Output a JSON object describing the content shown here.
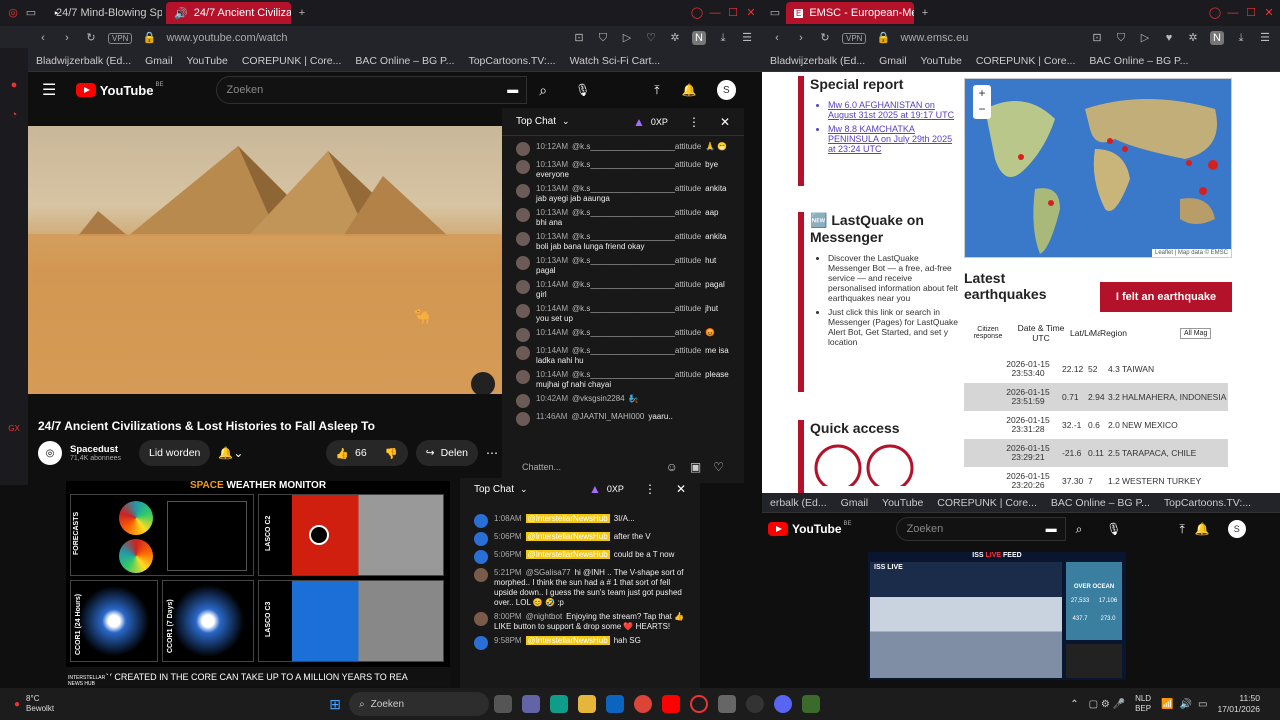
{
  "left_browser": {
    "tabs": [
      {
        "label": "24/7 Mind-Blowing Space"
      },
      {
        "label": "24/7 Ancient Civilizati"
      }
    ],
    "url": "www.youtube.com/watch",
    "vpn": "VPN",
    "bookmarks": [
      "Bladwijzerbalk (Ed...",
      "Gmail",
      "YouTube",
      "COREPUNK | Core...",
      "BAC Online – BG P...",
      "TopCartoons.TV:...",
      "Watch Sci-Fi Cart..."
    ]
  },
  "right_browser": {
    "tab": "EMSC - European-Mediter",
    "url": "www.emsc.eu",
    "vpn": "VPN",
    "bookmarks": [
      "Bladwijzerbalk (Ed...",
      "Gmail",
      "YouTube",
      "COREPUNK | Core...",
      "BAC Online – BG P..."
    ]
  },
  "youtube": {
    "logo": "YouTube",
    "region": "BE",
    "search_placeholder": "Zoeken",
    "avatar": "S",
    "video_title": "24/7 Ancient Civilizations & Lost Histories to Fall Asleep To",
    "channel": "Spacedust",
    "subs": "71,4K abonnees",
    "join": "Lid worden",
    "likes": "66",
    "share": "Delen"
  },
  "chat1": {
    "header": "Top Chat",
    "xp": "0XP",
    "placeholder": "Chatten...",
    "messages": [
      {
        "time": "10:12AM",
        "author": "@k.s___________________attitude",
        "text": "🙏 😁"
      },
      {
        "time": "10:13AM",
        "author": "@k.s___________________attitude",
        "text": "bye everyone"
      },
      {
        "time": "10:13AM",
        "author": "@k.s___________________attitude",
        "text": "ankita jab ayegi jab aaunga"
      },
      {
        "time": "10:13AM",
        "author": "@k.s___________________attitude",
        "text": "aap bhi ana"
      },
      {
        "time": "10:13AM",
        "author": "@k.s___________________attitude",
        "text": "ankita boli jab bana lunga friend okay"
      },
      {
        "time": "10:13AM",
        "author": "@k.s___________________attitude",
        "text": "hut pagal"
      },
      {
        "time": "10:14AM",
        "author": "@k.s___________________attitude",
        "text": "pagal girl"
      },
      {
        "time": "10:14AM",
        "author": "@k.s___________________attitude",
        "text": "jhut you set up"
      },
      {
        "time": "10:14AM",
        "author": "@k.s___________________attitude",
        "text": "😡"
      },
      {
        "time": "10:14AM",
        "author": "@k.s___________________attitude",
        "text": "me isa ladka nahi hu"
      },
      {
        "time": "10:14AM",
        "author": "@k.s___________________attitude",
        "text": "please mujhai gf nahi chayai"
      },
      {
        "time": "10:42AM",
        "author": "@vksgsin2284",
        "text": "🧞"
      },
      {
        "time": "11:46AM",
        "author": "@JAATNI_MAHI000",
        "text": "yaaru.."
      }
    ]
  },
  "space": {
    "title_a": "SPACE",
    "title_b": "WEATHER MONITOR",
    "labels": [
      "FORECASTS",
      "LASCO C2",
      "CCOR1 (24 Hours)",
      "CCOR1 (7 Days)",
      "LASCO C3"
    ],
    "date": "2026-01-21 00:00Z",
    "ticker": "Y CREATED IN THE CORE CAN TAKE UP TO A MILLION YEARS TO REA",
    "hub": "INTERSTELLAR NEWS HUB"
  },
  "chat2": {
    "header": "Top Chat",
    "xp": "0XP",
    "messages": [
      {
        "time": "1:08AM",
        "author": "@InterstellarNewsHub",
        "text": "3I/A..."
      },
      {
        "time": "5:06PM",
        "author": "@InterstellarNewsHub",
        "text": "after the V"
      },
      {
        "time": "5:06PM",
        "author": "@InterstellarNewsHub",
        "text": "could be a T now"
      },
      {
        "time": "5:21PM",
        "author": "@SGalisa77",
        "text": "hi @INH .. The V-shape sort of morphed.. I think the sun had a # 1 that sort of fell upside down.. I guess the sun's team just got pushed over.. LOL 😊 🤣 :p"
      },
      {
        "time": "8:00PM",
        "author": "@nightbot",
        "text": "Enjoying the stream? Tap that 👍 LIKE button to support & drop some ❤️ HEARTS!"
      },
      {
        "time": "9:58PM",
        "author": "@InterstellarNewsHub",
        "text": "hah SG"
      }
    ]
  },
  "emsc": {
    "special_title": "Special report",
    "reports": [
      "Mw 6.0 AFGHANISTAN on August 31st 2025 at 19:17 UTC",
      "Mw 8.8 KAMCHATKA PENINSULA on July 29th 2025 at 23:24 UTC"
    ],
    "lastquake_title": "🆕 LastQuake on Messenger",
    "lq_items": [
      "Discover the LastQuake Messenger Bot — a free, ad-free service — and receive personalised information about felt earthquakes near you",
      "Just click this link or search in Messenger (Pages) for LastQuake Alert Bot, Get Started, and set y location"
    ],
    "quick_access": "Quick access",
    "latest_title": "Latest earthquakes",
    "felt_button": "I felt an earthquake",
    "map_credit": "Leaflet | Map data © EMSC",
    "table_headers": [
      "Citizen response",
      "Date & Time UTC",
      "Lat/Lon",
      "Mag",
      "Region"
    ],
    "mag_filter": "All Mag",
    "quakes": [
      {
        "date": "2026-01-15",
        "time": "23:53:40",
        "lat": "22.12",
        "lon": "52",
        "mag": "4.3",
        "region": "TAIWAN"
      },
      {
        "date": "2026-01-15",
        "time": "23:51:59",
        "lat": "0.71",
        "lon": "2.94",
        "mag": "3.2",
        "region": "HALMAHERA, INDONESIA"
      },
      {
        "date": "2026-01-15",
        "time": "23:31:28",
        "lat": "32.-1",
        "lon": "0.6",
        "mag": "2.0",
        "region": "NEW MEXICO"
      },
      {
        "date": "2026-01-15",
        "time": "23:29:21",
        "lat": "-21.6",
        "lon": "0.11",
        "mag": "2.5",
        "region": "TARAPACA, CHILE"
      },
      {
        "date": "2026-01-15",
        "time": "23:20:26",
        "lat": "37.30",
        "lon": "7",
        "mag": "1.2",
        "region": "WESTERN TURKEY"
      }
    ]
  },
  "yt2": {
    "bookmarks": [
      "erbalk (Ed...",
      "Gmail",
      "YouTube",
      "COREPUNK | Core...",
      "BAC Online – BG P...",
      "TopCartoons.TV:..."
    ],
    "logo": "YouTube",
    "region": "BE",
    "search": "Zoeken",
    "avatar": "S",
    "iss_title_a": "ISS ",
    "iss_title_b": "LIVE",
    "iss_title_c": " FEED",
    "iss_live": "ISS LIVE",
    "over_ocean": "OVER OCEAN",
    "stats": [
      "27,533",
      "17,106",
      "437.7",
      "273.0"
    ]
  },
  "taskbar": {
    "temp": "8°C",
    "weather": "Bewolkt",
    "search": "Zoeken",
    "lang1": "NLD",
    "lang2": "BEP",
    "time": "11:50",
    "date": "17/01/2026"
  }
}
